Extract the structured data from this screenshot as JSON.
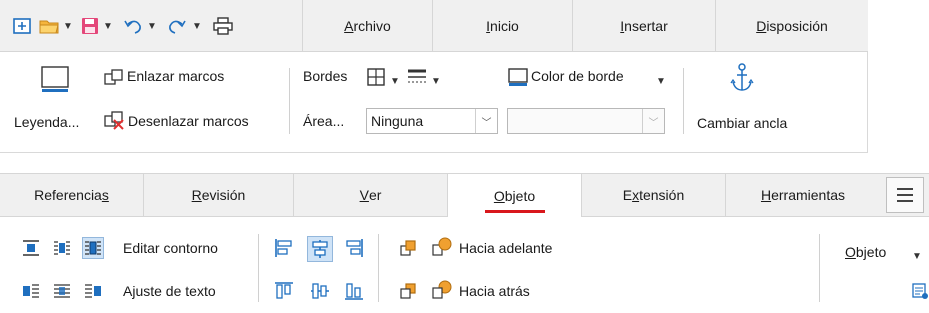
{
  "top": {
    "tabs": [
      {
        "pre": "",
        "mn": "A",
        "post": "rchivo"
      },
      {
        "pre": "",
        "mn": "I",
        "post": "nicio"
      },
      {
        "pre": "",
        "mn": "I",
        "post": "nsertar"
      },
      {
        "pre": "",
        "mn": "D",
        "post": "isposición"
      }
    ],
    "legend_label": "Leyenda...",
    "link_frames": "Enlazar marcos",
    "unlink_frames": "Desenlazar marcos",
    "borders_label": "Bordes",
    "area_label": "Área...",
    "area_value": "Ninguna",
    "border_color_label": "Color de borde",
    "anchor_label": "Cambiar ancla"
  },
  "bottom": {
    "tabs": [
      {
        "pre": "Referencia",
        "mn": "s",
        "post": "",
        "active": false
      },
      {
        "pre": "",
        "mn": "R",
        "post": "evisión",
        "active": false
      },
      {
        "pre": "",
        "mn": "V",
        "post": "er",
        "active": false
      },
      {
        "pre": "",
        "mn": "O",
        "post": "bjeto",
        "active": true
      },
      {
        "pre": "E",
        "mn": "x",
        "post": "tensión",
        "active": false
      },
      {
        "pre": "",
        "mn": "H",
        "post": "erramientas",
        "active": false
      }
    ],
    "edit_contour": "Editar contorno",
    "text_wrap": "Ajuste de texto",
    "bring_forward": "Hacia adelante",
    "send_backward": "Hacia atrás",
    "object_dropdown": {
      "mn": "O",
      "post": "bjeto"
    }
  },
  "colors": {
    "accent_red": "#d9171c",
    "icon_blue": "#1f6fbf",
    "selected_bg": "#cfe3f7",
    "icon_orange": "#f0a030"
  }
}
